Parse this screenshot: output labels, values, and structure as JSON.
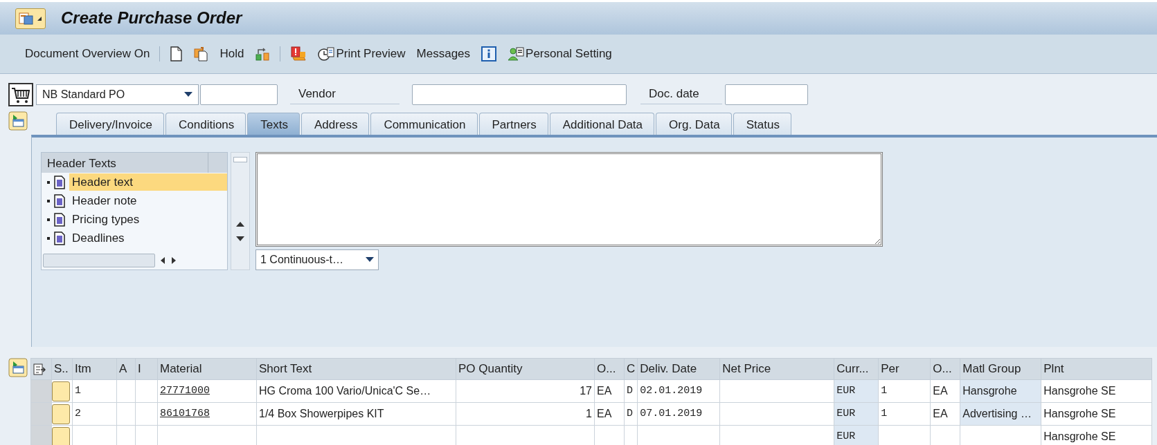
{
  "window": {
    "title": "Create Purchase Order"
  },
  "toolbar": [
    {
      "kind": "button",
      "label": "Document Overview On"
    },
    {
      "kind": "separator"
    },
    {
      "kind": "icon"
    },
    {
      "kind": "icon"
    },
    {
      "kind": "button",
      "label": "Hold"
    },
    {
      "kind": "icon"
    },
    {
      "kind": "separator"
    },
    {
      "kind": "icon"
    },
    {
      "kind": "icon_button",
      "label": "Print Preview"
    },
    {
      "kind": "button",
      "label": "Messages"
    },
    {
      "kind": "icon"
    },
    {
      "kind": "icon_button",
      "label": "Personal Setting"
    }
  ],
  "header": {
    "document_type": "NB Standard PO",
    "vendor_label": "Vendor",
    "doc_date_label": "Doc. date"
  },
  "tabs": [
    {
      "label": "Delivery/Invoice",
      "selected": false
    },
    {
      "label": "Conditions",
      "selected": false
    },
    {
      "label": "Texts",
      "selected": true
    },
    {
      "label": "Address",
      "selected": false
    },
    {
      "label": "Communication",
      "selected": false
    },
    {
      "label": "Partners",
      "selected": false
    },
    {
      "label": "Additional Data",
      "selected": false
    },
    {
      "label": "Org. Data",
      "selected": false
    },
    {
      "label": "Status",
      "selected": false
    }
  ],
  "header_texts": {
    "title": "Header Texts",
    "items": [
      {
        "label": "Header text",
        "selected": true
      },
      {
        "label": "Header note",
        "selected": false
      },
      {
        "label": "Pricing types",
        "selected": false
      },
      {
        "label": "Deadlines",
        "selected": false
      }
    ],
    "format": "1 Continuous-t…"
  },
  "items_table": {
    "columns": [
      "S..",
      "Itm",
      "A",
      "I",
      "Material",
      "Short Text",
      "PO Quantity",
      "O...",
      "C",
      "Deliv. Date",
      "Net Price",
      "Curr...",
      "Per",
      "O...",
      "Matl Group",
      "Plnt"
    ],
    "rows": [
      {
        "item": "1",
        "material": "27771000",
        "short_text": "HG Croma 100 Vario/Unica'C Se…",
        "po_quantity": "17",
        "order_unit": "EA",
        "date_category": "D",
        "delivery_date": "02.01.2019",
        "currency": "EUR",
        "price_unit": "1",
        "order_price_unit": "EA",
        "material_group": "Hansgrohe",
        "plant": "Hansgrohe SE"
      },
      {
        "item": "2",
        "material": "86101768",
        "short_text": "1/4 Box Showerpipes KIT",
        "po_quantity": "1",
        "order_unit": "EA",
        "date_category": "D",
        "delivery_date": "07.01.2019",
        "currency": "EUR",
        "price_unit": "1",
        "order_price_unit": "EA",
        "material_group": "Advertising …",
        "plant": "Hansgrohe SE"
      },
      {
        "currency": "EUR",
        "plant": "Hansgrohe SE"
      }
    ]
  }
}
